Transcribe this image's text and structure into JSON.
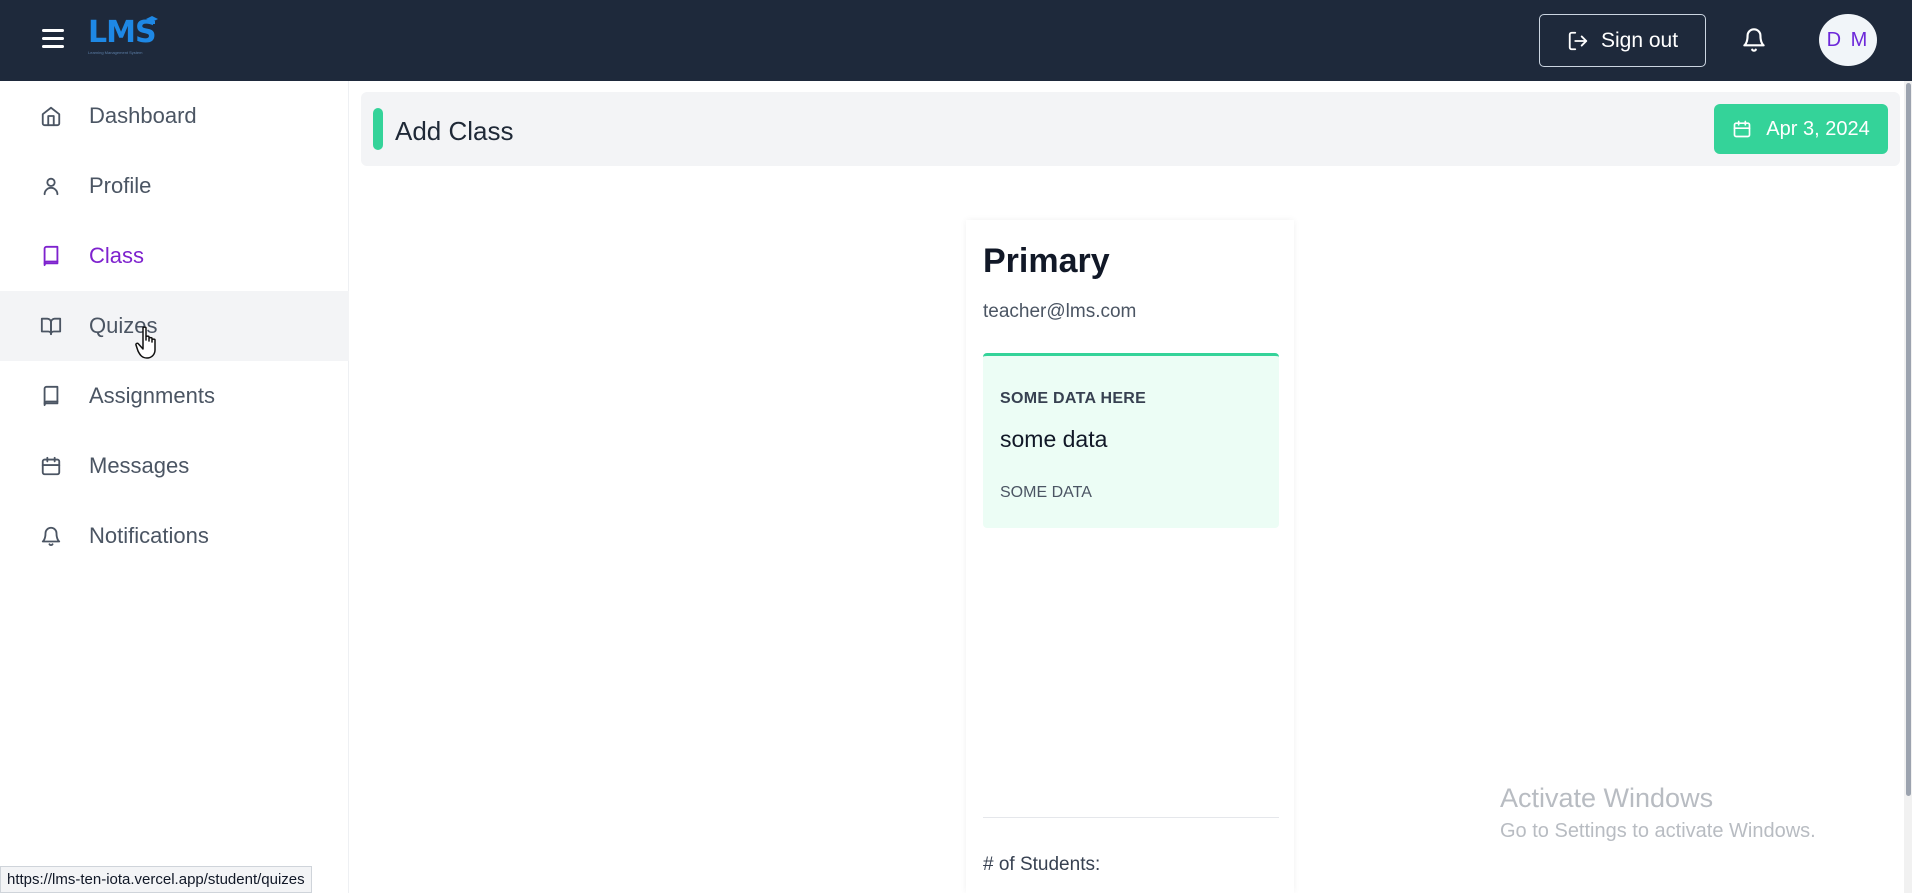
{
  "topbar": {
    "logo_text": "LMS",
    "logo_sub": "Learning Management System",
    "signout_label": "Sign out",
    "avatar_initials": "D M"
  },
  "sidebar": {
    "items": [
      {
        "label": "Dashboard",
        "icon": "home-icon"
      },
      {
        "label": "Profile",
        "icon": "user-icon"
      },
      {
        "label": "Class",
        "icon": "book-icon",
        "active": true
      },
      {
        "label": "Quizes",
        "icon": "book-open-icon",
        "hover": true
      },
      {
        "label": "Assignments",
        "icon": "book-icon"
      },
      {
        "label": "Messages",
        "icon": "calendar-icon"
      },
      {
        "label": "Notifications",
        "icon": "bell-icon"
      }
    ]
  },
  "header": {
    "title": "Add Class",
    "date": "Apr 3, 2024"
  },
  "card": {
    "title": "Primary",
    "email": "teacher@lms.com",
    "info_heading": "SOME DATA HERE",
    "info_value": "some data",
    "info_sub": "SOME DATA",
    "students_label": "# of Students:"
  },
  "watermark": {
    "title": "Activate Windows",
    "subtitle": "Go to Settings to activate Windows."
  },
  "status_bar": {
    "url": "https://lms-ten-iota.vercel.app/student/quizes"
  },
  "colors": {
    "topbar_bg": "#1e293b",
    "accent_green": "#34d399",
    "active_purple": "#7e22ce",
    "info_bg": "#ecfdf5"
  }
}
